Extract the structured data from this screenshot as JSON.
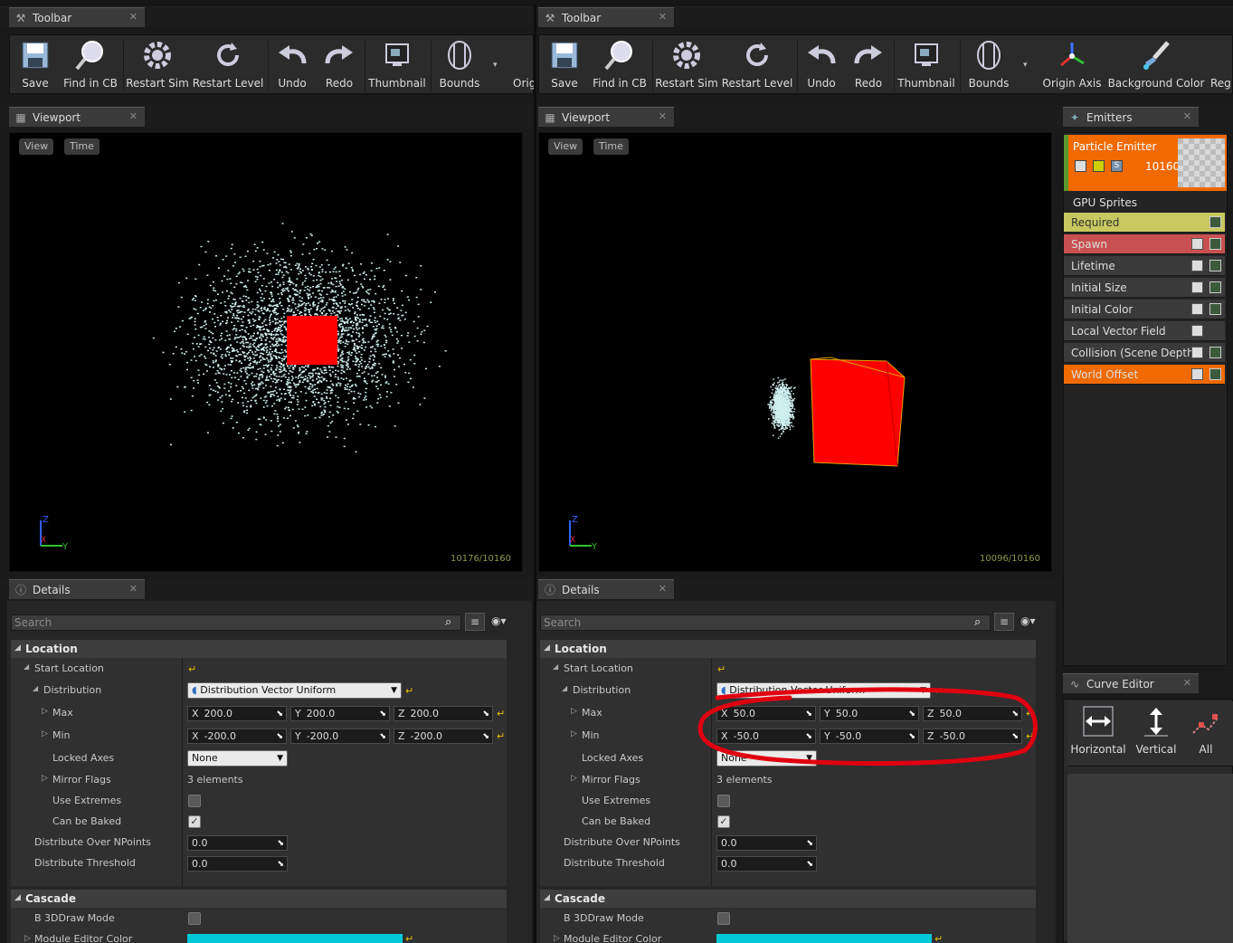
{
  "colors": {
    "accent_orange": "#f06a00",
    "required_yellow": "#c8c860",
    "spawn_red": "#c85050",
    "cube_red": "#ff0000",
    "module_color": "#00c8d8",
    "annotation_red": "#e00010",
    "particle": "#cfeeee"
  },
  "left": {
    "toolbar_tab": "Toolbar",
    "viewport_tab": "Viewport",
    "details_tab": "Details",
    "viewport_buttons": [
      "View",
      "Time"
    ],
    "particle_count": "10176/10160",
    "search_placeholder": "Search",
    "location": {
      "title": "Location",
      "start_location": "Start Location",
      "distribution": "Distribution",
      "distribution_value": "Distribution Vector Uniform",
      "max": "Max",
      "max_x": "200.0",
      "max_y": "200.0",
      "max_z": "200.0",
      "min": "Min",
      "min_x": "-200.0",
      "min_y": "-200.0",
      "min_z": "-200.0",
      "locked_axes": "Locked Axes",
      "locked_axes_value": "None",
      "mirror_flags": "Mirror Flags",
      "mirror_flags_value": "3 elements",
      "use_extremes": "Use Extremes",
      "can_be_baked": "Can be Baked",
      "distribute_over": "Distribute Over NPoints",
      "distribute_over_value": "0.0",
      "distribute_threshold": "Distribute Threshold",
      "distribute_threshold_value": "0.0"
    },
    "cascade": {
      "title": "Cascade",
      "b3d": "B 3DDraw Mode",
      "module_editor_color": "Module Editor Color"
    }
  },
  "right": {
    "toolbar_tab": "Toolbar",
    "viewport_tab": "Viewport",
    "details_tab": "Details",
    "viewport_buttons": [
      "View",
      "Time"
    ],
    "particle_count": "10096/10160",
    "search_placeholder": "Search",
    "location": {
      "title": "Location",
      "start_location": "Start Location",
      "distribution": "Distribution",
      "distribution_value": "Distribution Vector Uniform",
      "max": "Max",
      "max_x": "50.0",
      "max_y": "50.0",
      "max_z": "50.0",
      "min": "Min",
      "min_x": "-50.0",
      "min_y": "-50.0",
      "min_z": "-50.0",
      "locked_axes": "Locked Axes",
      "locked_axes_value": "None",
      "mirror_flags": "Mirror Flags",
      "mirror_flags_value": "3 elements",
      "use_extremes": "Use Extremes",
      "can_be_baked": "Can be Baked",
      "distribute_over": "Distribute Over NPoints",
      "distribute_over_value": "0.0",
      "distribute_threshold": "Distribute Threshold",
      "distribute_threshold_value": "0.0"
    },
    "cascade": {
      "title": "Cascade",
      "b3d": "B 3DDraw Mode",
      "module_editor_color": "Module Editor Color"
    }
  },
  "toolbar_buttons": {
    "save": "Save",
    "find": "Find in CB",
    "restart_sim": "Restart Sim",
    "restart_level": "Restart Level",
    "undo": "Undo",
    "redo": "Redo",
    "thumbnail": "Thumbnail",
    "bounds": "Bounds",
    "origin_cut": "Orig",
    "origin_axis": "Origin Axis",
    "background_color": "Background Color",
    "reg_cut": "Reg"
  },
  "emitters": {
    "tab": "Emitters",
    "emitter_name": "Particle Emitter",
    "emitter_count": "10160",
    "type": "GPU Sprites",
    "modules": [
      "Required",
      "Spawn",
      "Lifetime",
      "Initial Size",
      "Initial Color",
      "Local Vector Field",
      "Collision (Scene Depth)",
      "World Offset"
    ]
  },
  "curve_editor": {
    "tab": "Curve Editor",
    "horizontal": "Horizontal",
    "vertical": "Vertical",
    "all": "All"
  },
  "axis_labels": {
    "z": "Z",
    "x": "X",
    "y": "Y"
  }
}
